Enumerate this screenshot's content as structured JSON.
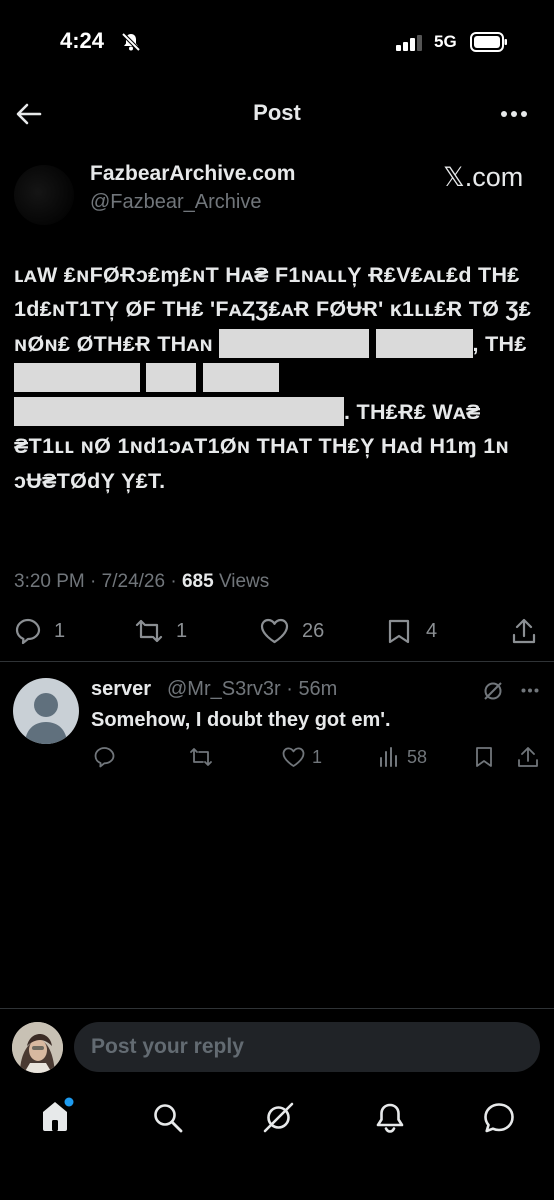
{
  "status_bar": {
    "time": "4:24",
    "network": "5G"
  },
  "header": {
    "title": "Post"
  },
  "post": {
    "author_name": "FazbearArchive.com",
    "author_handle": "@Fazbear_Archive",
    "source_label": "𝕏.com",
    "text_parts": [
      "ʟᴀW ₤ɴFØɌɔ₤ɱ₤ɴT Hᴀ₴ F1ɴᴀʟʟY̦ Ɍ₤V₤ᴀʟ₤d TH₤ 1d₤ɴT1TY̦ ØF TH₤ 'FᴀⱫƷ₤ᴀɌ FØɄɌ' ĸ1ʟʟ₤Ɍ TØ Ʒ₤ ɴØɴ₤ ØTH₤Ɍ THᴀɴ",
      ",",
      "TH₤",
      ". TH₤Ɍ₤ Wᴀ₴ ₴T1ʟʟ ɴØ 1ɴd1ɔᴀT1Øɴ THᴀT TH₤Y̦ Hᴀd H1ɱ 1ɴ ɔɄ₴TØdY̦ Y̦₤T."
    ],
    "time": "3:20 PM",
    "date": "7/24/26",
    "views_count": "685",
    "views_label": "Views",
    "replies": "1",
    "reposts": "1",
    "likes": "26",
    "bookmarks": "4"
  },
  "reply": {
    "name": "server",
    "handle": "@Mr_S3rv3r",
    "age": "56m",
    "text": "Somehow, I doubt they got em'.",
    "likes": "1",
    "views": "58"
  },
  "compose": {
    "placeholder": "Post your reply"
  },
  "colors": {
    "background": "#000000",
    "text": "#e7e9ea",
    "muted": "#71767b",
    "accent": "#1d9bf0"
  },
  "nav": [
    "home-icon",
    "search-icon",
    "grok-icon",
    "notifications-icon",
    "messages-icon"
  ]
}
